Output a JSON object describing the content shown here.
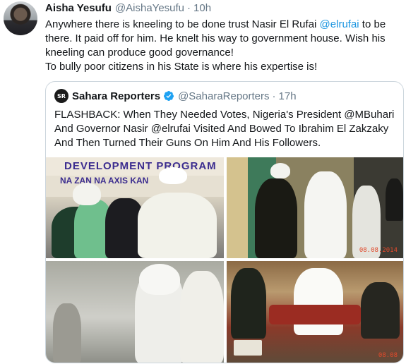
{
  "tweet": {
    "author_name": "Aisha Yesufu",
    "author_handle": "@AishaYesufu",
    "separator": "·",
    "time": "10h",
    "text_line1_pre": "Anywhere there is kneeling to be done trust Nasir El Rufai ",
    "text_mention": "@elrufai",
    "text_line1_post": " to be there. It paid off for him. He knelt his way to government house. Wish his kneeling can produce good governance!",
    "text_line2": "To bully poor citizens in his State is where his expertise is!"
  },
  "quote": {
    "logo_text": "SR",
    "name": "Sahara Reporters",
    "handle": "@SaharaReporters",
    "separator": "·",
    "time": "17h",
    "text": "FLASHBACK: When They Needed Votes, Nigeria's President @MBuhari  And Governor Nasir @elrufai Visited And Bowed To Ibrahim El Zakzaky And Then Turned Their Guns On Him And His Followers."
  },
  "media": {
    "photo1_banner_line1": "DEVELOPMENT   PROGRAM",
    "photo1_banner_line2": "NA ZAN  NA  AXIS   KAN",
    "photo2_stamp": "08.08.2014",
    "photo4_stamp": "08.08"
  },
  "colors": {
    "link": "#1b95e0",
    "verified": "#1da1f2",
    "secondary_text": "#657786",
    "border": "#ccd6dd"
  }
}
